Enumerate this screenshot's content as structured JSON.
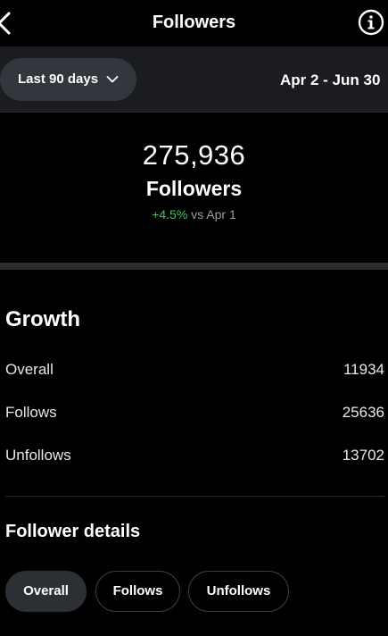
{
  "header": {
    "title": "Followers",
    "back_icon": "chevron-left-icon",
    "info_icon": "info-icon"
  },
  "range": {
    "selected": "Last 90 days",
    "dropdown_icon": "chevron-down-icon",
    "dates": "Apr 2 - Jun 30"
  },
  "summary": {
    "count": "275,936",
    "label": "Followers",
    "change_pct": "+4.5%",
    "change_ref": "vs Apr 1"
  },
  "growth": {
    "title": "Growth",
    "rows": [
      {
        "label": "Overall",
        "value": "11934"
      },
      {
        "label": "Follows",
        "value": "25636"
      },
      {
        "label": "Unfollows",
        "value": "13702"
      }
    ]
  },
  "details": {
    "title": "Follower details",
    "filters": [
      {
        "label": "Overall",
        "active": true
      },
      {
        "label": "Follows",
        "active": false
      },
      {
        "label": "Unfollows",
        "active": false
      }
    ]
  },
  "colors": {
    "positive": "#3ec45b",
    "background": "#000000",
    "pill": "#33363c"
  }
}
